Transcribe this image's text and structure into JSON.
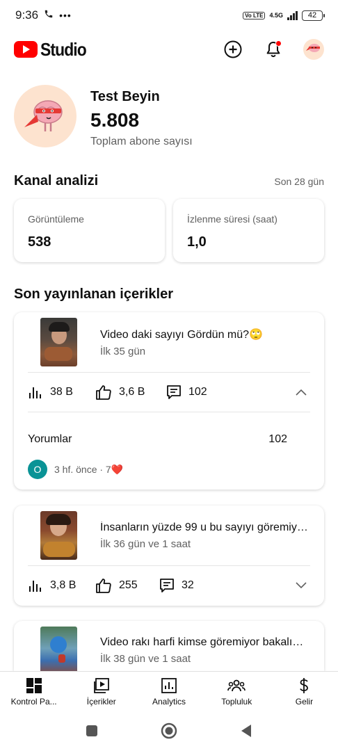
{
  "status_bar": {
    "time": "9:36",
    "volte": "Vo LTE",
    "network": "4.5G",
    "battery": "42"
  },
  "app_bar": {
    "logo_text": "Studio",
    "icons": [
      "create-icon",
      "notifications-icon",
      "account-avatar"
    ]
  },
  "channel": {
    "name": "Test Beyin",
    "subscriber_count": "5.808",
    "subscriber_label": "Toplam abone sayısı"
  },
  "analytics": {
    "title": "Kanal analizi",
    "period": "Son 28 gün",
    "cards": [
      {
        "label": "Görüntüleme",
        "value": "538"
      },
      {
        "label": "İzlenme süresi (saat)",
        "value": "1,0"
      }
    ]
  },
  "recent": {
    "title": "Son yayınlanan içerikler",
    "videos": [
      {
        "title": "Video daki sayıyı Gördün mü?🙄",
        "age": "İlk 35 gün",
        "views": "38 B",
        "likes": "3,6 B",
        "comments": "102",
        "expanded": true,
        "comments_label": "Yorumlar",
        "comments_total": "102",
        "comment_avatar": "O",
        "comment_meta": "3 hf. önce · 7❤️"
      },
      {
        "title": "İnsanların yüzde 99 u bu sayıyı göremiyor...",
        "age": "İlk 36 gün ve 1 saat",
        "views": "3,8 B",
        "likes": "255",
        "comments": "32",
        "expanded": false
      },
      {
        "title": "Video rakı harfi kimse göremiyor bakalım...",
        "age": "İlk 38 gün ve 1 saat"
      }
    ]
  },
  "bottom_nav": [
    {
      "label": "Kontrol Pa...",
      "icon": "dashboard-icon"
    },
    {
      "label": "İçerikler",
      "icon": "content-icon"
    },
    {
      "label": "Analytics",
      "icon": "analytics-icon"
    },
    {
      "label": "Topluluk",
      "icon": "community-icon"
    },
    {
      "label": "Gelir",
      "icon": "earn-icon"
    }
  ],
  "colors": {
    "brand_red": "#ff0000",
    "text_primary": "#0f0f0f",
    "text_secondary": "#606060",
    "comment_avatar": "#0a9396"
  }
}
